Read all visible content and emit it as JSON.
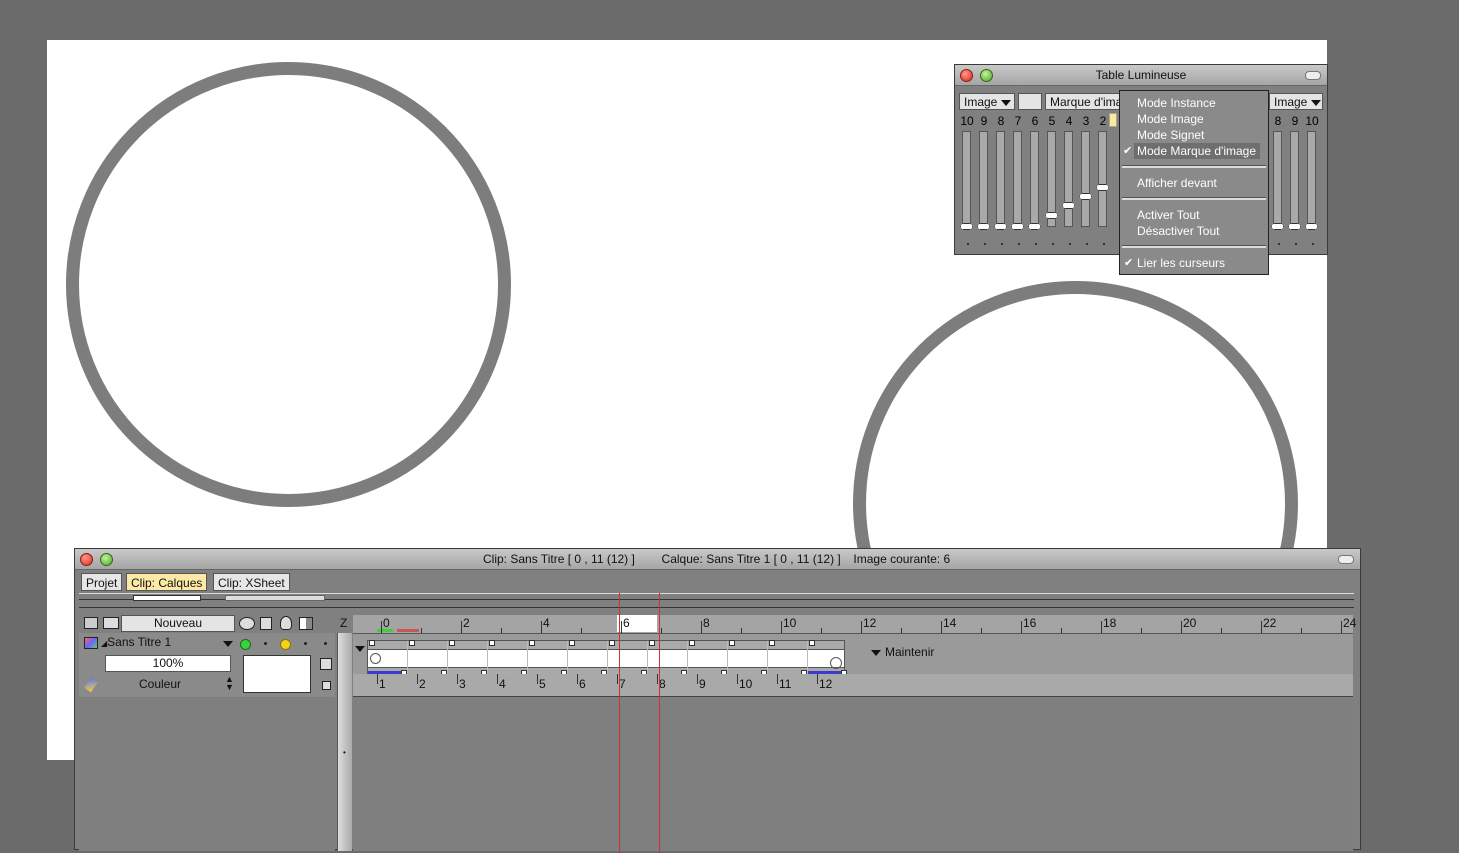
{
  "light_table": {
    "title": "Table Lumineuse",
    "left_mode": "Image",
    "middle_dropdown": "Marque d'image",
    "right_mode": "Image",
    "left_numbers": [
      "10",
      "9",
      "8",
      "7",
      "6",
      "5",
      "4",
      "3",
      "2"
    ],
    "right_numbers": [
      "8",
      "9",
      "10"
    ]
  },
  "context_menu": {
    "items": [
      {
        "label": "Mode Instance",
        "checked": false
      },
      {
        "label": "Mode Image",
        "checked": false
      },
      {
        "label": "Mode Signet",
        "checked": false
      },
      {
        "label": "Mode Marque d'image",
        "checked": true
      },
      {
        "label": "Afficher devant",
        "checked": false
      },
      {
        "label": "Activer Tout",
        "checked": false
      },
      {
        "label": "Désactiver Tout",
        "checked": false
      },
      {
        "label": "Lier les curseurs",
        "checked": true
      }
    ]
  },
  "timeline": {
    "status_clip": "Clip: Sans Titre [ 0 , 11  (12) ]",
    "status_layer": "Calque: Sans Titre 1 [ 0 , 11  (12) ]",
    "status_frame": "Image courante: 6",
    "tabs": [
      "Projet",
      "Clip: Calques",
      "Clip: XSheet"
    ],
    "active_tab": "Clip: Calques",
    "new_button": "Nouveau",
    "z_label": "Z",
    "layer_name": "Sans Titre 1",
    "opacity": "100%",
    "color_mode": "Couleur",
    "hold_label": "Maintenir",
    "ruler_labels": [
      "0",
      "2",
      "4",
      "6",
      "8",
      "10",
      "12",
      "14",
      "16",
      "18",
      "20",
      "22",
      "24"
    ],
    "current_frame": "6",
    "frame_labels": [
      "1",
      "2",
      "3",
      "4",
      "5",
      "6",
      "7",
      "8",
      "9",
      "10",
      "11",
      "12"
    ]
  },
  "colors": {
    "active_tab": "#fde9a6",
    "range_bar": "#3a3acc",
    "onion_line": "#d03030"
  }
}
